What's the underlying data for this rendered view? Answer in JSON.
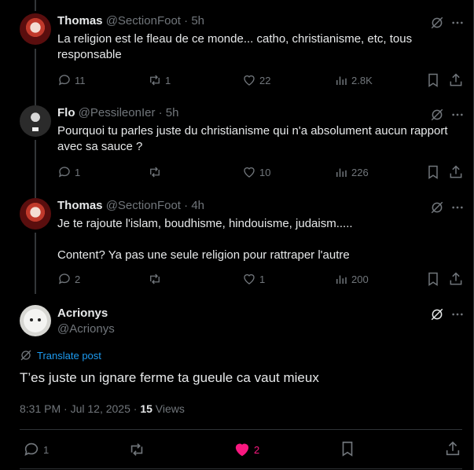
{
  "replies": [
    {
      "name": "Thomas",
      "handle": "@SectionFoot",
      "time": "5h",
      "text": "La religion est le fleau de ce monde... catho, christianisme, etc, tous responsable",
      "replies": "11",
      "reposts": "1",
      "likes": "22",
      "views": "2.8K",
      "avatar": "avatar-thomas"
    },
    {
      "name": "Flo",
      "handle": "@PessileonIer",
      "time": "5h",
      "text": "Pourquoi tu parles juste du christianisme qui n'a absolument aucun rapport avec sa sauce ?",
      "replies": "1",
      "reposts": "",
      "likes": "10",
      "views": "226",
      "avatar": "avatar-flo"
    },
    {
      "name": "Thomas",
      "handle": "@SectionFoot",
      "time": "4h",
      "text_line1": "Je te rajoute l'islam, boudhisme, hindouisme, judaism.....",
      "text_line2": "Content? Ya pas une seule religion pour rattraper l'autre",
      "replies": "2",
      "reposts": "",
      "likes": "1",
      "views": "200",
      "avatar": "avatar-thomas"
    }
  ],
  "main": {
    "name": "Acrionys",
    "handle": "@Acrionys",
    "translate": "Translate post",
    "text": "T’es juste un ignare ferme ta gueule ca vaut mieux",
    "timestamp": "8:31 PM · Jul 12, 2025 · ",
    "views_count": "15",
    "views_label": " Views",
    "replies": "1",
    "likes": "2"
  },
  "colors": {
    "background": "#000000",
    "text": "#e7e9ea",
    "muted": "#71767b",
    "link": "#1d9bf0",
    "like_active": "#f91880",
    "divider": "#2f3336"
  },
  "icons": [
    "grok-icon",
    "more-icon",
    "reply-icon",
    "repost-icon",
    "like-icon",
    "views-icon",
    "bookmark-icon",
    "share-icon",
    "translate-icon"
  ]
}
